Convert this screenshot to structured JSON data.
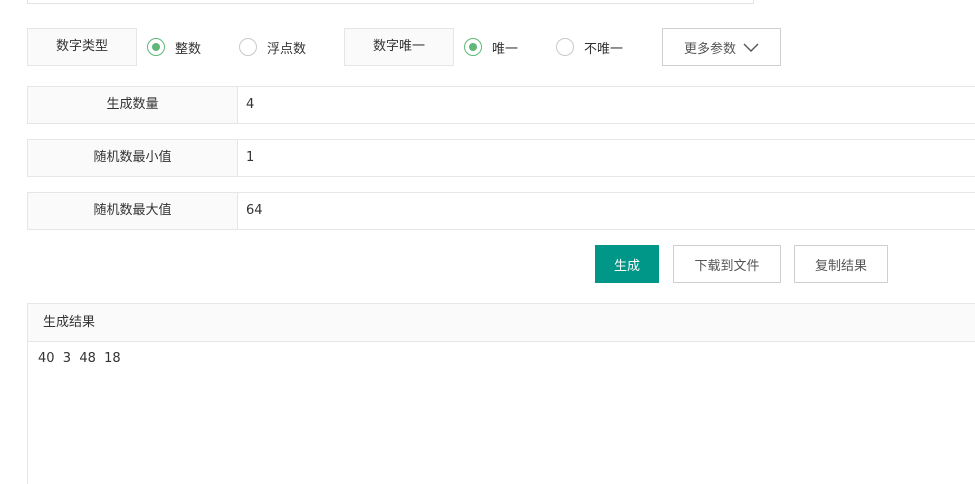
{
  "options": {
    "number_type": {
      "label": "数字类型",
      "choices": [
        {
          "label": "整数",
          "checked": true
        },
        {
          "label": "浮点数",
          "checked": false
        }
      ]
    },
    "uniqueness": {
      "label": "数字唯一",
      "choices": [
        {
          "label": "唯一",
          "checked": true
        },
        {
          "label": "不唯一",
          "checked": false
        }
      ]
    },
    "more_button": "更多参数"
  },
  "form": {
    "count": {
      "label": "生成数量",
      "value": "4"
    },
    "min": {
      "label": "随机数最小值",
      "value": "1"
    },
    "max": {
      "label": "随机数最大值",
      "value": "64"
    }
  },
  "actions": {
    "generate": "生成",
    "download": "下载到文件",
    "copy": "复制结果"
  },
  "result": {
    "title": "生成结果",
    "content": "40  3  48  18"
  },
  "colors": {
    "accent": "#009688",
    "radio_checked": "#5fb878"
  }
}
